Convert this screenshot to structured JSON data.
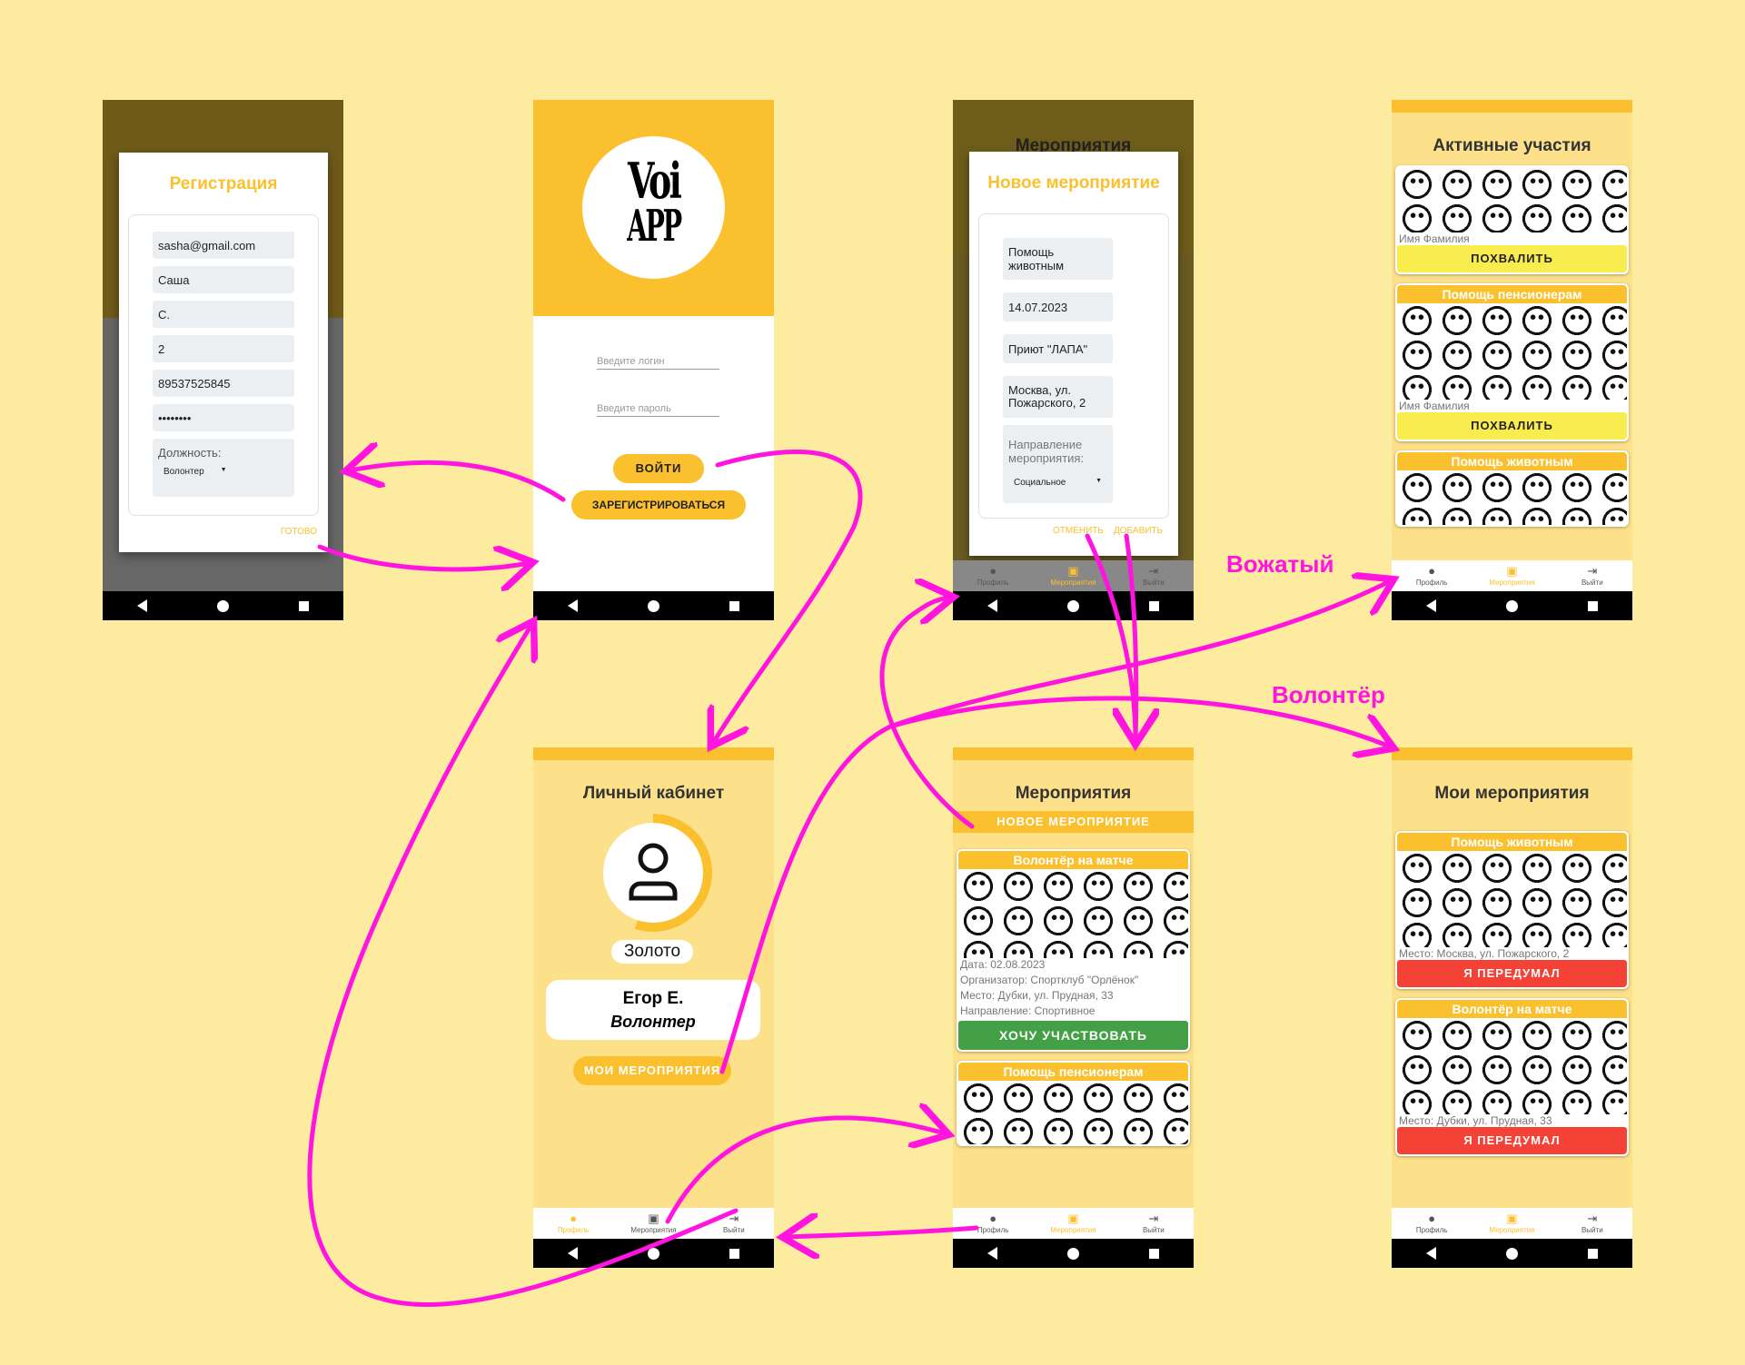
{
  "registration": {
    "title": "Регистрация",
    "email": "sasha@gmail.com",
    "first_name": "Саша",
    "last_initial": "С.",
    "number": "2",
    "phone": "89537525845",
    "password": "••••••••",
    "role_label": "Должность:",
    "role_value": "Волонтер",
    "done": "ГОТОВО"
  },
  "login": {
    "logo_top": "Voi",
    "logo_bottom": "APP",
    "login_placeholder": "Введите логин",
    "password_placeholder": "Введите пароль",
    "login_button": "ВОЙТИ",
    "register_button": "ЗАРЕГИСТРИРОВАТЬСЯ"
  },
  "new_event": {
    "bg_title": "Мероприятия",
    "title": "Новое мероприятие",
    "name": "Помощь животным",
    "date": "14.07.2023",
    "organizer": "Приют \"ЛАПА\"",
    "address": "Москва, ул. Пожарского, 2",
    "direction_label": "Направление мероприятия:",
    "direction_value": "Социальное",
    "cancel": "ОТМЕНИТЬ",
    "add": "ДОБАВИТЬ"
  },
  "tabs": {
    "profile": "Профиль",
    "events": "Мероприятия",
    "logout": "Выйти"
  },
  "active": {
    "title": "Активные участия",
    "name1": "Имя Фамилия",
    "praise": "ПОХВАЛИТЬ",
    "card2_title": "Помощь пенсионерам",
    "name2": "Имя Фамилия",
    "card3_title": "Помощь животным"
  },
  "cabinet": {
    "title": "Личный кабинет",
    "rank": "Золото",
    "name": "Егор Е.",
    "role": "Волонтер",
    "my_events": "МОИ МЕРОПРИЯТИЯ",
    "progress": 0.55
  },
  "events": {
    "title": "Мероприятия",
    "new_event": "НОВОЕ МЕРОПРИЯТИЕ",
    "card1_title": "Волонтёр на матче",
    "card1_date": "Дата: 02.08.2023",
    "card1_org": "Организатор: Спортклуб \"Орлёнок\"",
    "card1_place": "Место: Дубки, ул. Прудная, 33",
    "card1_dir": "Направление: Спортивное",
    "join": "ХОЧУ УЧАСТВОВАТЬ",
    "card2_title": "Помощь пенсионерам"
  },
  "my_events": {
    "title": "Мои мероприятия",
    "card1_title": "Помощь животным",
    "card1_place": "Место: Москва, ул. Пожарского, 2",
    "changed_mind": "Я ПЕРЕДУМАЛ",
    "card2_title": "Волонтёр на матче",
    "card2_place": "Место: Дубки, ул. Прудная, 33"
  },
  "labels": {
    "leader": "Вожатый",
    "volunteer": "Волонтёр"
  },
  "colors": {
    "background": "#fdeb9f",
    "accent": "#fbc02d",
    "arrow": "#ff14e0",
    "green": "#43a047",
    "red": "#f44336",
    "praise": "#f9ec4f"
  }
}
